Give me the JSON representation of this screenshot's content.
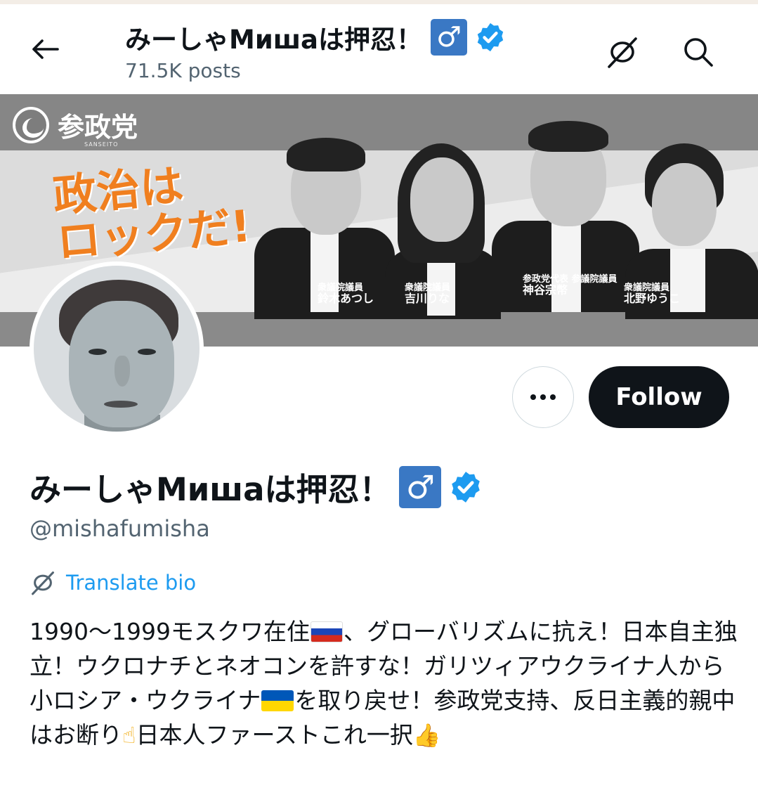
{
  "header": {
    "title": "みーしゃМишаは押忍！",
    "badge": "♂",
    "posts": "71.5K posts"
  },
  "banner": {
    "logo_text": "参政党",
    "logo_sub": "SANSEITO",
    "slogan_line1": "政治は",
    "slogan_line2": "ロックだ!",
    "people": [
      {
        "role": "衆議院議員",
        "name": "鈴木あつし"
      },
      {
        "role": "衆議院議員",
        "name": "吉川りな"
      },
      {
        "role": "参政党代表 参議院議員",
        "name": "神谷宗幣"
      },
      {
        "role": "衆議院議員",
        "name": "北野ゆうこ"
      }
    ]
  },
  "profile": {
    "display_name": "みーしゃМишаは押忍！",
    "badge": "♂",
    "handle": "@mishafumisha",
    "translate_label": "Translate bio",
    "follow_label": "Follow",
    "more_label": "•••",
    "bio_part1": "1990〜1999モスクワ在住",
    "bio_part2": "、グローバリズムに抗え！日本自主独立！ウクロナチとネオコンを許すな！ガリツィアウクライナ人から小ロシア・ウクライナ",
    "bio_part3": "を取り戻せ！参政党支持、反日主義的親中はお断り",
    "bio_part4": "日本人ファーストこれ一択",
    "emoji_point": "☝",
    "emoji_thumb": "👍"
  },
  "colors": {
    "accent": "#1d9bf0",
    "verified": "#1d9bf0",
    "badge_bg": "#3a78c4",
    "follow_bg": "#0f1419",
    "muted": "#536471"
  },
  "icons": [
    "back-arrow-icon",
    "translate-icon",
    "search-icon",
    "verified-icon",
    "more-icon"
  ]
}
